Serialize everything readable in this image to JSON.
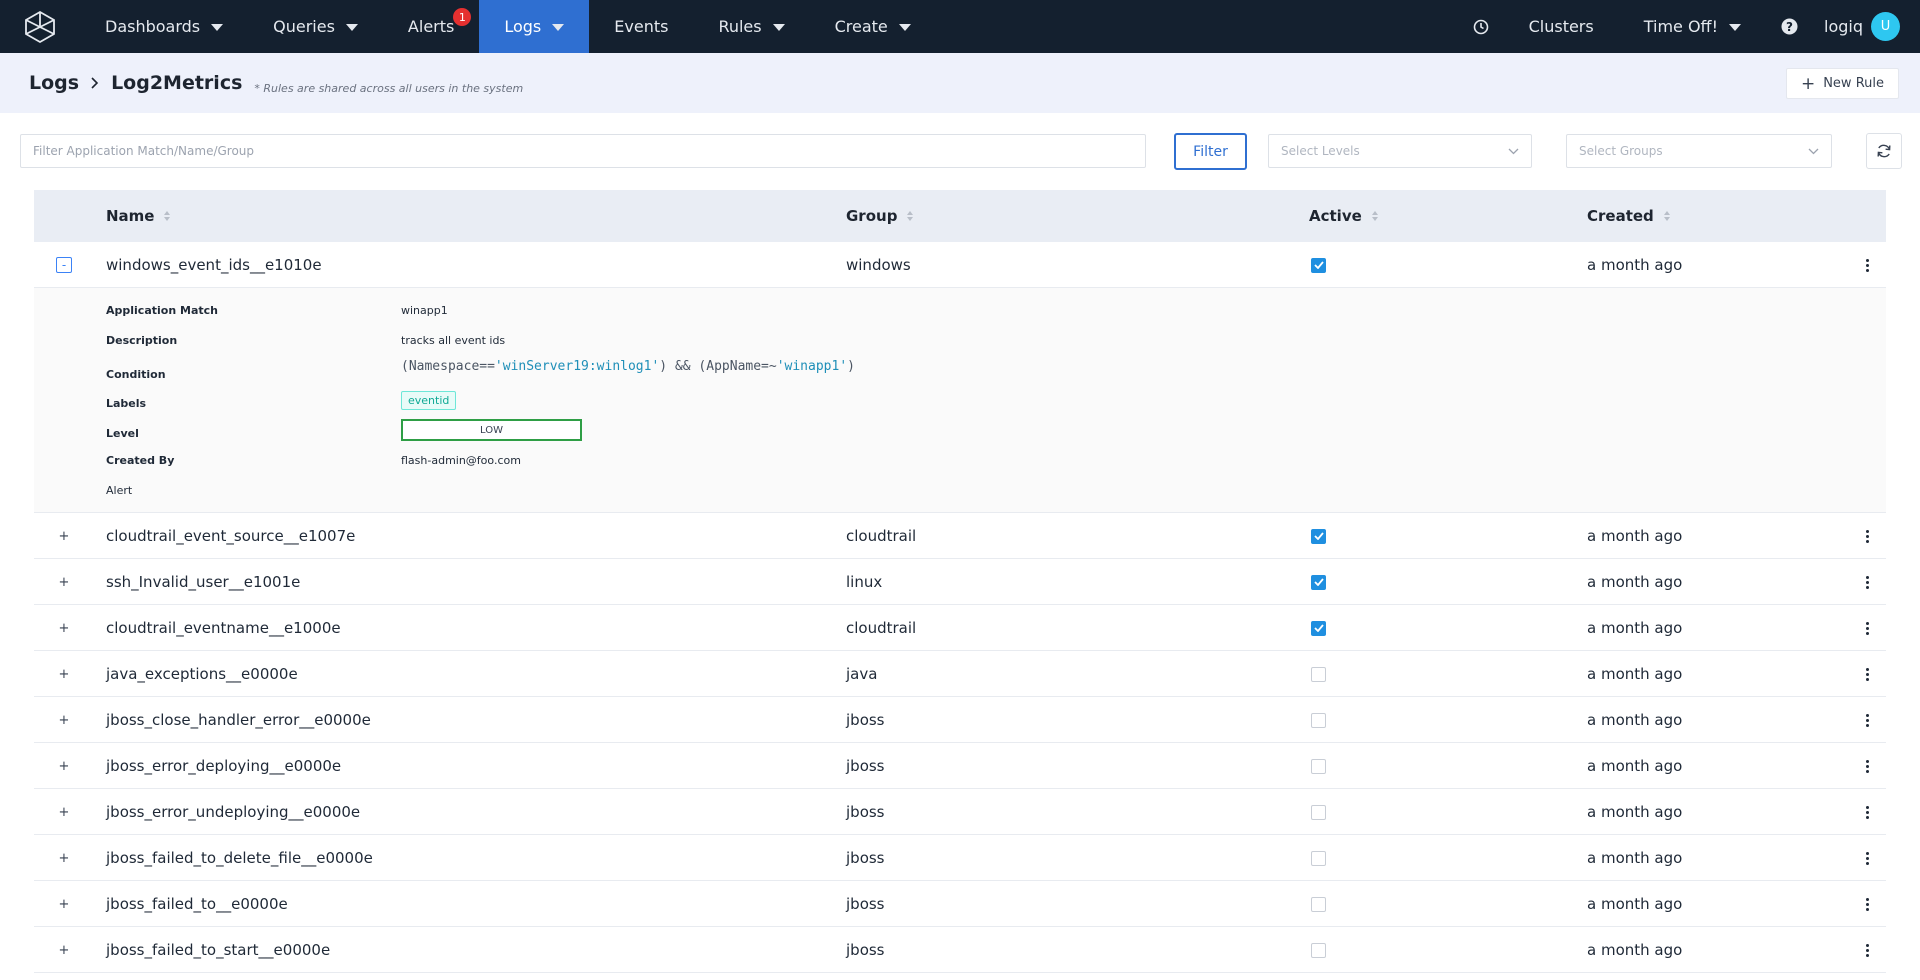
{
  "nav": {
    "items": [
      {
        "label": "Dashboards",
        "dropdown": true
      },
      {
        "label": "Queries",
        "dropdown": true
      },
      {
        "label": "Alerts",
        "dropdown": false,
        "badge": "1"
      },
      {
        "label": "Logs",
        "dropdown": true,
        "active": true
      },
      {
        "label": "Events",
        "dropdown": false
      },
      {
        "label": "Rules",
        "dropdown": true
      },
      {
        "label": "Create",
        "dropdown": true
      }
    ],
    "right": {
      "clusters": "Clusters",
      "timeoff": "Time Off!",
      "user": "logiq",
      "avatar_initial": "U"
    },
    "colors": {
      "bar": "#14202f",
      "active": "#2f6fd1",
      "badge": "#e53030"
    }
  },
  "breadcrumb": {
    "root": "Logs",
    "current": "Log2Metrics",
    "note": "* Rules are shared across all users in the system",
    "new_rule": "New Rule"
  },
  "filters": {
    "search_placeholder": "Filter Application Match/Name/Group",
    "filter_button": "Filter",
    "levels_placeholder": "Select Levels",
    "groups_placeholder": "Select Groups"
  },
  "table": {
    "columns": {
      "name": "Name",
      "group": "Group",
      "active": "Active",
      "created": "Created"
    },
    "expanded": {
      "name": "windows_event_ids__e1010e",
      "group": "windows",
      "active": true,
      "created": "a month ago",
      "labels": {
        "app_match": "Application Match",
        "description": "Description",
        "condition": "Condition",
        "labels": "Labels",
        "level": "Level",
        "created_by": "Created By",
        "alert": "Alert"
      },
      "values": {
        "app_match": "winapp1",
        "description": "tracks all event ids",
        "condition_a": "(Namespace==",
        "condition_b": "'winServer19:winlog1'",
        "condition_c": ") && (AppName=~",
        "condition_d": "'winapp1'",
        "condition_e": ")",
        "label_tag": "eventid",
        "level": "LOW",
        "created_by": "flash-admin@foo.com"
      }
    },
    "rows": [
      {
        "name": "cloudtrail_event_source__e1007e",
        "group": "cloudtrail",
        "active": true,
        "created": "a month ago"
      },
      {
        "name": "ssh_Invalid_user__e1001e",
        "group": "linux",
        "active": true,
        "created": "a month ago"
      },
      {
        "name": "cloudtrail_eventname__e1000e",
        "group": "cloudtrail",
        "active": true,
        "created": "a month ago"
      },
      {
        "name": "java_exceptions__e0000e",
        "group": "java",
        "active": false,
        "created": "a month ago"
      },
      {
        "name": "jboss_close_handler_error__e0000e",
        "group": "jboss",
        "active": false,
        "created": "a month ago"
      },
      {
        "name": "jboss_error_deploying__e0000e",
        "group": "jboss",
        "active": false,
        "created": "a month ago"
      },
      {
        "name": "jboss_error_undeploying__e0000e",
        "group": "jboss",
        "active": false,
        "created": "a month ago"
      },
      {
        "name": "jboss_failed_to_delete_file__e0000e",
        "group": "jboss",
        "active": false,
        "created": "a month ago"
      },
      {
        "name": "jboss_failed_to__e0000e",
        "group": "jboss",
        "active": false,
        "created": "a month ago"
      },
      {
        "name": "jboss_failed_to_start__e0000e",
        "group": "jboss",
        "active": false,
        "created": "a month ago"
      }
    ],
    "expand_symbol": "+",
    "collapse_symbol": "-"
  }
}
